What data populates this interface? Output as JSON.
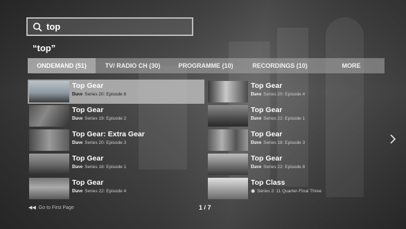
{
  "search": {
    "query": "top",
    "icon": "search-icon"
  },
  "query_heading": "“top”",
  "tabs": [
    {
      "label": "ONDEMAND (51)",
      "active": true
    },
    {
      "label": "TV/ RADIO CH (30)",
      "active": false
    },
    {
      "label": "PROGRAMME (10)",
      "active": false
    },
    {
      "label": "RECORDINGS (10)",
      "active": false
    },
    {
      "label": "MORE",
      "active": false
    }
  ],
  "results_left": [
    {
      "title": "Top Gear",
      "channel": "Dave",
      "episode": "Series 20: Episode 6"
    },
    {
      "title": "Top Gear",
      "channel": "Dave",
      "episode": "Series 19: Episode 2"
    },
    {
      "title": "Top Gear: Extra Gear",
      "channel": "Dave",
      "episode": "Series 20: Episode 3"
    },
    {
      "title": "Top Gear",
      "channel": "Dave",
      "episode": "Series 18: Episode 1"
    },
    {
      "title": "Top Gear",
      "channel": "Dave",
      "episode": "Series 22: Episode 4"
    }
  ],
  "results_right": [
    {
      "title": "Top Gear",
      "channel": "Dave",
      "episode": "Series 20: Episode 4"
    },
    {
      "title": "Top Gear",
      "channel": "Dave",
      "episode": "Series 22: Episode 1"
    },
    {
      "title": "Top Gear",
      "channel": "Dave",
      "episode": "Series 18: Episode 3"
    },
    {
      "title": "Top Gear",
      "channel": "Dave",
      "episode": "Series 22: Episode 8"
    },
    {
      "title": "Top Class",
      "channel": "",
      "episode": "Series 2: 11 Quarter-Final Three"
    }
  ],
  "footer": {
    "first_page": "Go to First Page",
    "pagination": "1 / 7"
  }
}
